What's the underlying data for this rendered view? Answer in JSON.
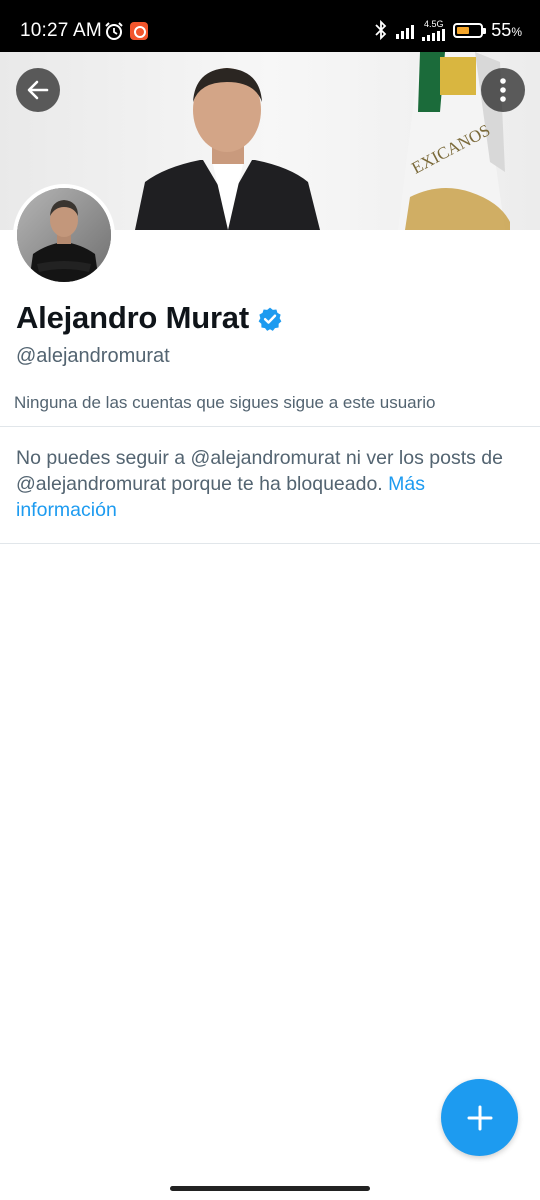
{
  "status_bar": {
    "time": "10:27 AM",
    "network_type": "4.5G",
    "battery_percent": "55",
    "battery_unit": "%",
    "battery_level": 0.55,
    "icons": [
      "alarm-icon",
      "app-notification-icon",
      "bluetooth-icon",
      "signal-icon",
      "battery-icon"
    ]
  },
  "header": {
    "back_icon": "arrow-left-icon",
    "more_icon": "more-vertical-icon"
  },
  "profile": {
    "name": "Alejandro Murat",
    "verified": true,
    "handle": "@alejandromurat",
    "followers_note": "Ninguna de las cuentas que sigues sigue a este usuario",
    "banner_flag_text": "EXICANOS"
  },
  "blocked_notice": {
    "text": "No puedes seguir a @alejandromurat ni ver los posts de @alejandromurat porque te ha bloqueado.",
    "link_label": "Más información"
  },
  "fab": {
    "icon": "plus-icon"
  },
  "colors": {
    "accent": "#1d9bf0",
    "text_primary": "#0f1419",
    "text_secondary": "#536471",
    "battery_fill": "#f4a52a"
  }
}
